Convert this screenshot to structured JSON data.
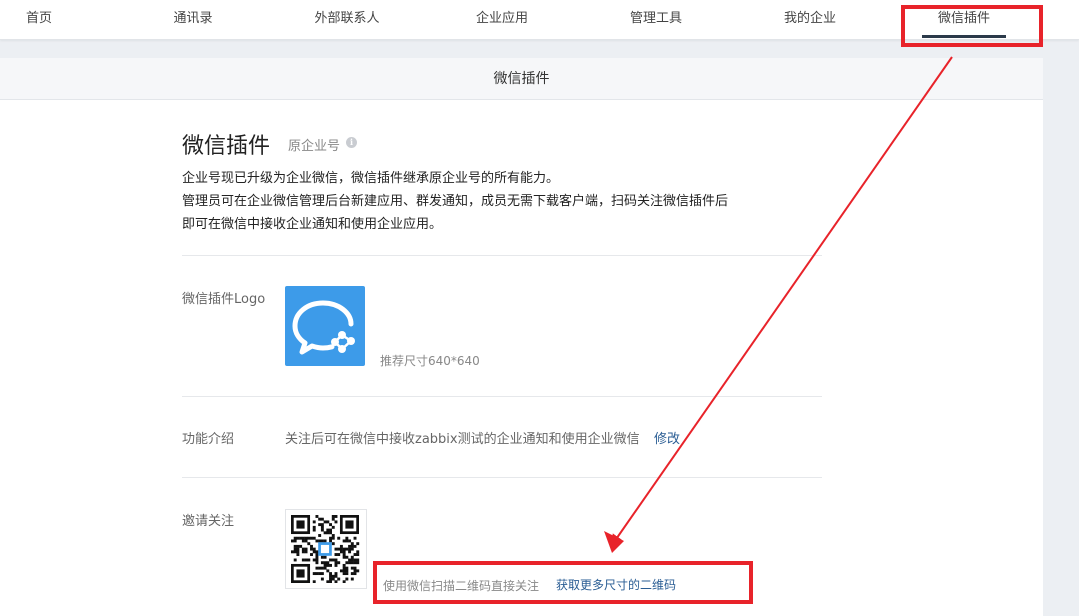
{
  "nav": {
    "items": [
      {
        "label": "首页"
      },
      {
        "label": "通讯录"
      },
      {
        "label": "外部联系人"
      },
      {
        "label": "企业应用"
      },
      {
        "label": "管理工具"
      },
      {
        "label": "我的企业"
      },
      {
        "label": "微信插件"
      }
    ],
    "active_index": 6
  },
  "panel": {
    "header_title": "微信插件"
  },
  "page": {
    "title": "微信插件",
    "subtitle": "原企业号",
    "description": [
      "企业号现已升级为企业微信，微信插件继承原企业号的所有能力。",
      "管理员可在企业微信管理后台新建应用、群发通知，成员无需下载客户端，扫码关注微信插件后",
      "即可在微信中接收企业通知和使用企业应用。"
    ]
  },
  "logo_row": {
    "label": "微信插件Logo",
    "hint": "推荐尺寸640*640"
  },
  "intro_row": {
    "label": "功能介绍",
    "text": "关注后可在微信中接收zabbix测试的企业通知和使用企业微信",
    "edit_link": "修改"
  },
  "invite_row": {
    "label": "邀请关注",
    "hint": "使用微信扫描二维码直接关注",
    "more_link": "获取更多尺寸的二维码"
  },
  "colors": {
    "annotation_red": "#e8232a",
    "logo_blue": "#3d9be9",
    "link_blue": "#2a5d94"
  },
  "icons": [
    "wecom-chat-icon",
    "info-icon",
    "qr-code-image"
  ]
}
